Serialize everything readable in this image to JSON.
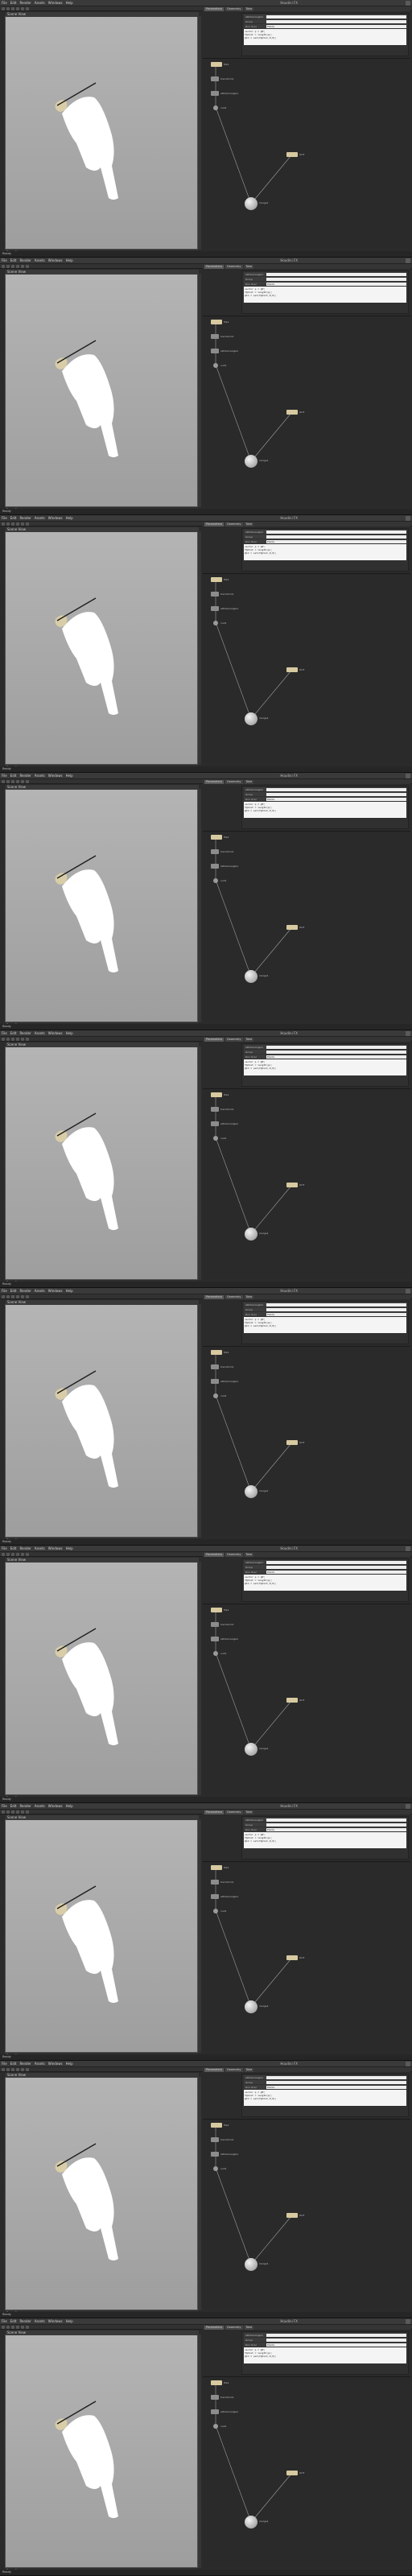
{
  "app": {
    "menu": [
      "File",
      "Edit",
      "Render",
      "Assets",
      "Windows",
      "Help"
    ],
    "window_title": "Houdini FX"
  },
  "viewport": {
    "header": "Scene View",
    "footer": "Persp  No cam"
  },
  "panel": {
    "tabs": [
      "Parameters",
      "Geometry",
      "Take"
    ],
    "node_name": "attribwrangle1",
    "param_label_1": "Group",
    "param_label_2": "Run Over",
    "param_value_2": "Points",
    "code": "vector p = @P;\nf@dist = length(p);\n@Cd = set(f@dist,0,0);"
  },
  "network": {
    "nodes": [
      {
        "label": "file1",
        "kind": "tan"
      },
      {
        "label": "transform1",
        "kind": "gray"
      },
      {
        "label": "attribwrangle1",
        "kind": "gray"
      },
      {
        "label": "null1",
        "kind": "gray"
      },
      {
        "label": "OUT",
        "kind": "tan"
      },
      {
        "label": "merge1",
        "kind": "sphere"
      }
    ]
  },
  "status": "Ready",
  "colors": {
    "viewport_bg_top": "#b4b4b4",
    "viewport_bg_bottom": "#9e9e9e",
    "node_tan": "#d7c9a0",
    "ui_dark": "#2b2b2b"
  }
}
